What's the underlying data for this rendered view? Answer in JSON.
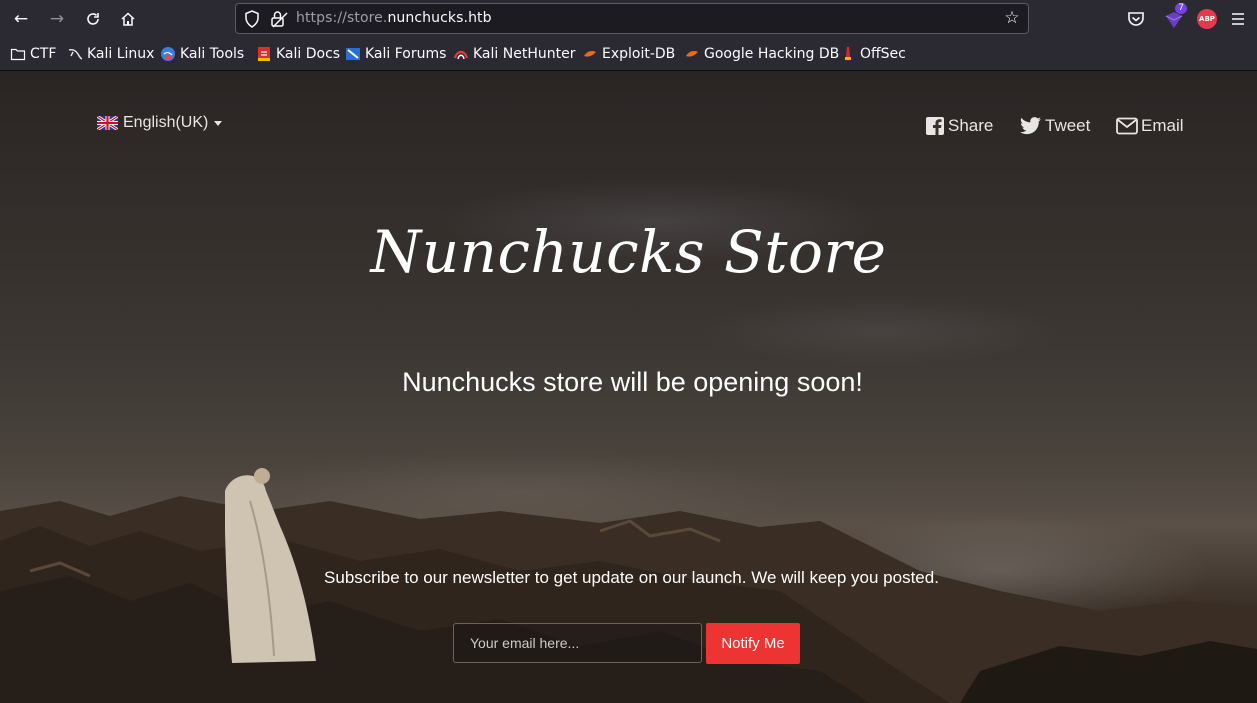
{
  "browser": {
    "url_prefix": "https://store.",
    "url_domain": "nunchucks.htb",
    "extension_badge": "7",
    "abp_label": "ABP"
  },
  "bookmarks": [
    {
      "label": "CTF",
      "icon": "folder-icon"
    },
    {
      "label": "Kali Linux",
      "icon": "kali-dragon-icon"
    },
    {
      "label": "Kali Tools",
      "icon": "kali-tools-icon"
    },
    {
      "label": "Kali Docs",
      "icon": "kali-docs-icon"
    },
    {
      "label": "Kali Forums",
      "icon": "kali-forums-icon"
    },
    {
      "label": "Kali NetHunter",
      "icon": "nethunter-icon"
    },
    {
      "label": "Exploit-DB",
      "icon": "exploit-db-icon"
    },
    {
      "label": "Google Hacking DB",
      "icon": "ghdb-icon"
    },
    {
      "label": "OffSec",
      "icon": "offsec-icon"
    }
  ],
  "page": {
    "language": "English(UK)",
    "share": {
      "share_label": "Share",
      "tweet_label": "Tweet",
      "email_label": "Email"
    },
    "brand": "Nunchucks Store",
    "tagline": "Nunchucks store will be opening soon!",
    "subscribe_text": "Subscribe to our newsletter to get update on our launch. We will keep you posted.",
    "email_placeholder": "Your email here...",
    "notify_label": "Notify Me"
  },
  "colors": {
    "notify_button": "#ee3333",
    "chrome": "#2b2a33"
  }
}
